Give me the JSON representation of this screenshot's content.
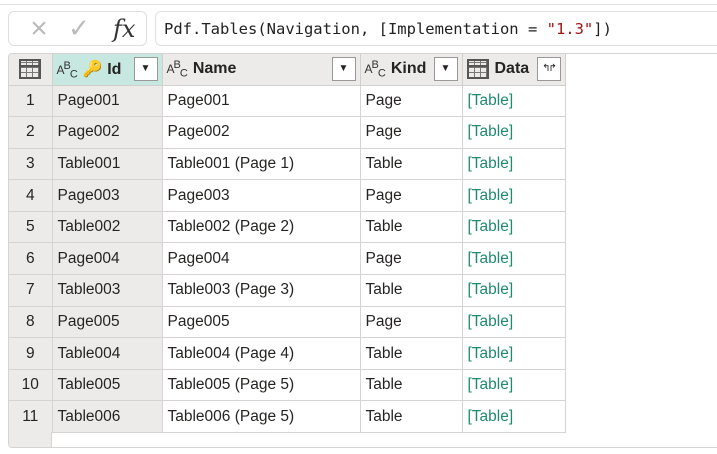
{
  "formula_bar": {
    "cancel_icon": "×",
    "commit_icon": "✓",
    "fx_label": "fx",
    "formula_prefix": "Pdf.Tables(Navigation, [Implementation = ",
    "formula_string": "\"1.3\"",
    "formula_suffix": "])"
  },
  "columns": [
    {
      "label": "Id",
      "type": "text",
      "key": true
    },
    {
      "label": "Name",
      "type": "text"
    },
    {
      "label": "Kind",
      "type": "text"
    },
    {
      "label": "Data",
      "type": "table"
    }
  ],
  "type_badge": "ABC",
  "expand_icon": "↰↱",
  "dropdown_icon": "▼",
  "rows": [
    {
      "n": "1",
      "id": "Page001",
      "name": "Page001",
      "kind": "Page",
      "data": "[Table]"
    },
    {
      "n": "2",
      "id": "Page002",
      "name": "Page002",
      "kind": "Page",
      "data": "[Table]"
    },
    {
      "n": "3",
      "id": "Table001",
      "name": "Table001 (Page 1)",
      "kind": "Table",
      "data": "[Table]"
    },
    {
      "n": "4",
      "id": "Page003",
      "name": "Page003",
      "kind": "Page",
      "data": "[Table]"
    },
    {
      "n": "5",
      "id": "Table002",
      "name": "Table002 (Page 2)",
      "kind": "Table",
      "data": "[Table]"
    },
    {
      "n": "6",
      "id": "Page004",
      "name": "Page004",
      "kind": "Page",
      "data": "[Table]"
    },
    {
      "n": "7",
      "id": "Table003",
      "name": "Table003 (Page 3)",
      "kind": "Table",
      "data": "[Table]"
    },
    {
      "n": "8",
      "id": "Page005",
      "name": "Page005",
      "kind": "Page",
      "data": "[Table]"
    },
    {
      "n": "9",
      "id": "Table004",
      "name": "Table004 (Page 4)",
      "kind": "Table",
      "data": "[Table]"
    },
    {
      "n": "10",
      "id": "Table005",
      "name": "Table005 (Page 5)",
      "kind": "Table",
      "data": "[Table]"
    },
    {
      "n": "11",
      "id": "Table006",
      "name": "Table006 (Page 5)",
      "kind": "Table",
      "data": "[Table]"
    }
  ]
}
